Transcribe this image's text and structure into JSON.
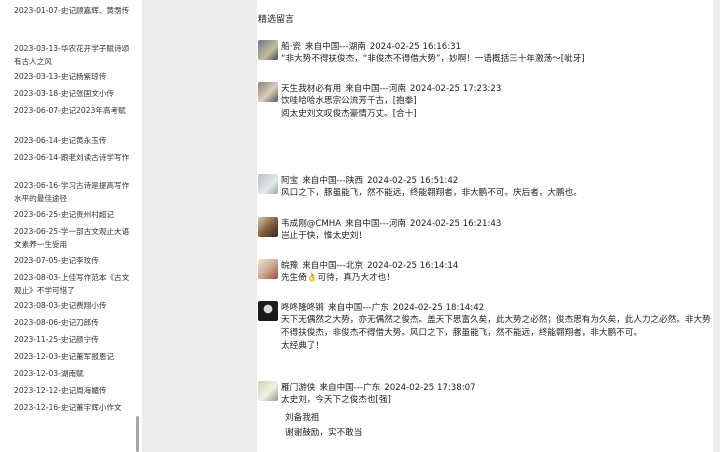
{
  "sidebar": {
    "items": [
      {
        "label": "2023-01-07-史记顾嘉辉、黄霑传"
      },
      {
        "label": "2023-03-13-华农花开学子赋诗颂有古人之风"
      },
      {
        "label": "2023-03-13-史记杨紫琼传"
      },
      {
        "label": "2023-03-18-史记张国文小传"
      },
      {
        "label": "2023-06-07-史记2023年高考赋"
      },
      {
        "label": "2023-06-14-史记黄永玉传"
      },
      {
        "label": "2023-06-14-跟老刘读古诗学写作"
      },
      {
        "label": "2023-06-16-学习古诗是提高写作水平的最佳途径"
      },
      {
        "label": "2023-06-25-史记贵州村超记"
      },
      {
        "label": "2023-06-25-学一部古文观止大语文素养一生受用"
      },
      {
        "label": "2023-07-05-史记李玟传"
      },
      {
        "label": "2023-08-03-上佳写作范本《古文观止》不学可惜了"
      },
      {
        "label": "2023-08-03-史记费翔小传"
      },
      {
        "label": "2023-08-06-史记刀郎传"
      },
      {
        "label": "2023-11-25-史记颜宁传"
      },
      {
        "label": "2023-12-03-史记董军报恩记"
      },
      {
        "label": "2023-12-03-湖南赋"
      },
      {
        "label": "2023-12-12-史记周海媚传"
      },
      {
        "label": "2023-12-16-史记董宇辉小作文"
      }
    ]
  },
  "main": {
    "title": "精选留言",
    "comments": [
      {
        "name": "船·瓷",
        "location": "来自中国---湖南",
        "time": "2024-02-25 16:16:31",
        "body": "“非大势不得扶俊杰，“非俊杰不得借大势”，妙啊！一语概括三十年激荡～[呲牙]"
      },
      {
        "name": "天生我材必有用",
        "location": "来自中国---河南",
        "time": "2024-02-25 17:23:23",
        "body": "饮哇哈哈水思宗公流芳千古，[抱拳]\n阅太史刘文叹俊杰豪情万丈。[合十]"
      },
      {
        "name": "阿宝",
        "location": "来自中国---陕西",
        "time": "2024-02-25 16:51:42",
        "body": "风口之下，豚虽能飞，然不能远，终能翱翔者，非大鹏不可。庆后者，大鹏也。"
      },
      {
        "name": "韦成刚@CMHA",
        "location": "来自中国---河南",
        "time": "2024-02-25 16:21:43",
        "body": "岂止于快，惟太史刘！"
      },
      {
        "name": "皖豫",
        "location": "来自中国---北京",
        "time": "2024-02-25 16:14:14",
        "body": "先生倚👌可待，真乃大才也！"
      },
      {
        "name": "咚咚隆咚锵",
        "location": "来自中国---广东",
        "time": "2024-02-25 18:14:42",
        "body": "天下无偶然之大势，亦无偶然之俊杰。盖天下思富久矣，此大势之必然；俊杰思有为久矣，此人力之必然。非大势不得扶俊杰，非俊杰不得借大势。风口之下，豚虽能飞，然不能远，终能翱翔者，非大鹏不可。\n太经典了！"
      },
      {
        "name": "雁门游侠",
        "location": "来自中国---广东",
        "time": "2024-02-25 17:38:07",
        "body": "太史刘，今天下之俊杰也[强]",
        "reply_author": "刘备我祖",
        "reply_text": "谢谢鼓励，实不敢当"
      }
    ]
  },
  "colors": {
    "gutter": "#ececec",
    "text": "#222222",
    "scroll_thumb": "#a6a6a6"
  }
}
